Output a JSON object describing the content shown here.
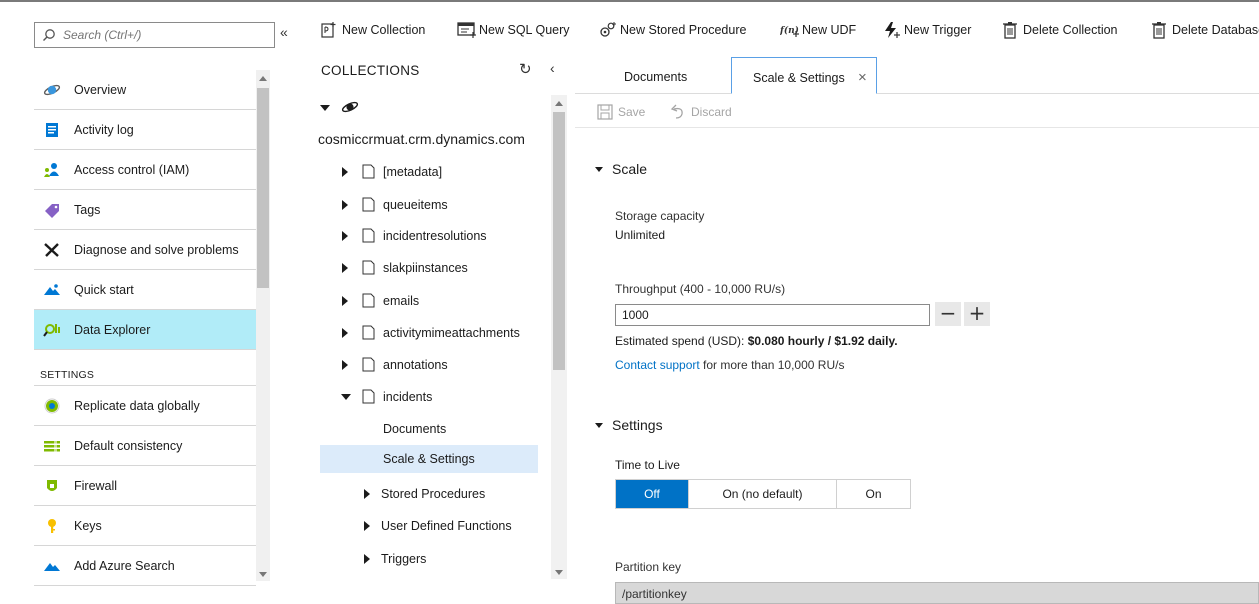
{
  "left_menu": {
    "search": {
      "placeholder": "Search (Ctrl+/)",
      "value": ""
    },
    "collapse_glyph": "«",
    "items": [
      {
        "label": "Overview",
        "icon": "overview-icon"
      },
      {
        "label": "Activity log",
        "icon": "activity-log-icon"
      },
      {
        "label": "Access control (IAM)",
        "icon": "access-control-icon"
      },
      {
        "label": "Tags",
        "icon": "tag-icon"
      },
      {
        "label": "Diagnose and solve problems",
        "icon": "wrench-icon"
      },
      {
        "label": "Quick start",
        "icon": "quickstart-icon"
      },
      {
        "label": "Data Explorer",
        "icon": "data-explorer-icon",
        "selected": true
      }
    ],
    "settings_header": "SETTINGS",
    "settings_items": [
      {
        "label": "Replicate data globally",
        "icon": "globe-icon"
      },
      {
        "label": "Default consistency",
        "icon": "consistency-icon"
      },
      {
        "label": "Firewall",
        "icon": "firewall-icon"
      },
      {
        "label": "Keys",
        "icon": "key-icon"
      },
      {
        "label": "Add Azure Search",
        "icon": "search-service-icon"
      }
    ]
  },
  "toolbar": {
    "new_collection": "New Collection",
    "new_sql_query": "New SQL Query",
    "new_stored_procedure": "New Stored Procedure",
    "new_udf": "New UDF",
    "new_trigger": "New Trigger",
    "delete_collection": "Delete Collection",
    "delete_database": "Delete Database"
  },
  "tree": {
    "title": "COLLECTIONS",
    "database": "cosmiccrmuat.crm.dynamics.com",
    "collections": [
      "[metadata]",
      "queueitems",
      "incidentresolutions",
      "slakpiinstances",
      "emails",
      "activitymimeattachments",
      "annotations",
      "incidents"
    ],
    "incidents_children": [
      "Documents",
      "Scale & Settings",
      "Stored Procedures",
      "User Defined Functions",
      "Triggers"
    ],
    "selected": "Scale & Settings"
  },
  "tabs": {
    "documents": "Documents",
    "scale_settings": "Scale & Settings",
    "close_glyph": "×"
  },
  "commands": {
    "save": "Save",
    "discard": "Discard"
  },
  "scale": {
    "header": "Scale",
    "storage_label": "Storage capacity",
    "storage_value": "Unlimited",
    "throughput_label": "Throughput (400 - 10,000 RU/s)",
    "throughput_value": "1000",
    "minus": "−",
    "plus": "+",
    "spend_prefix": "Estimated spend (USD): ",
    "spend_value": "$0.080 hourly / $1.92 daily.",
    "support_link": "Contact support",
    "support_suffix": " for more than 10,000 RU/s"
  },
  "settings": {
    "header": "Settings",
    "ttl_label": "Time to Live",
    "ttl_options": [
      "Off",
      "On (no default)",
      "On"
    ],
    "ttl_selected": "Off",
    "partition_label": "Partition key",
    "partition_value": "/partitionkey"
  },
  "colors": {
    "selected_menu": "#b1ecf8",
    "selected_tree": "#dcebfa",
    "accent": "#0072c6",
    "link": "#0072c6"
  }
}
